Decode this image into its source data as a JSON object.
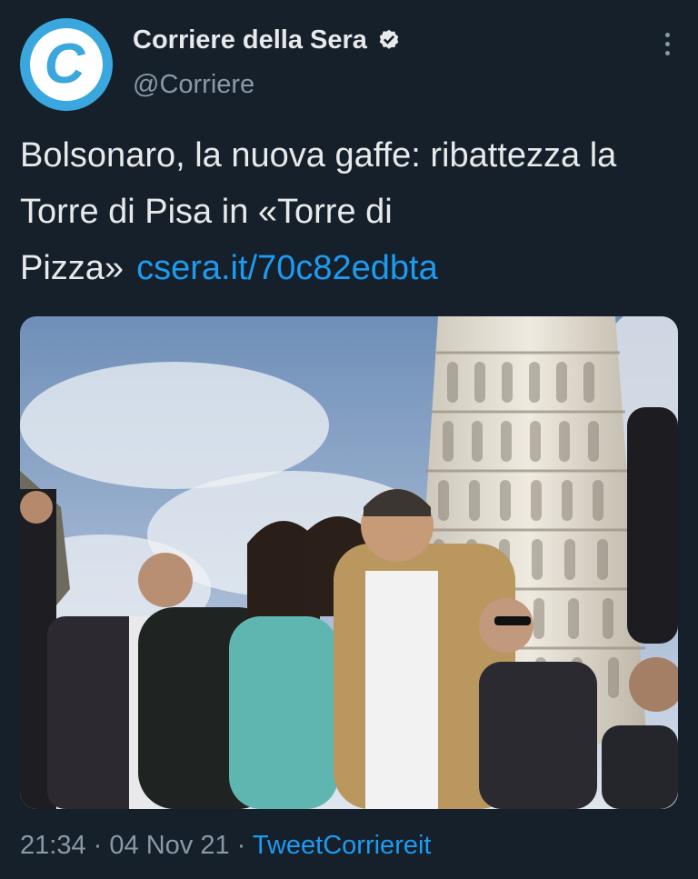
{
  "account": {
    "display_name": "Corriere della Sera",
    "handle": "@Corriere",
    "avatar_letter": "C",
    "verified": true
  },
  "tweet": {
    "text": "Bolsonaro, la nuova gaffe: ribattezza la Torre di Pisa in «Torre di Pizza»",
    "link": "csera.it/70c82edbta"
  },
  "meta": {
    "time": "21:34",
    "separator": "·",
    "date": "04 Nov 21",
    "source": "TweetCorriereit"
  },
  "colors": {
    "background": "#15202b",
    "text": "#e7e9ea",
    "secondary": "#8b98a5",
    "link": "#1d9bf0",
    "avatar": "#3aa8de"
  },
  "icons": [
    "verified-badge-icon",
    "more-options-icon"
  ]
}
